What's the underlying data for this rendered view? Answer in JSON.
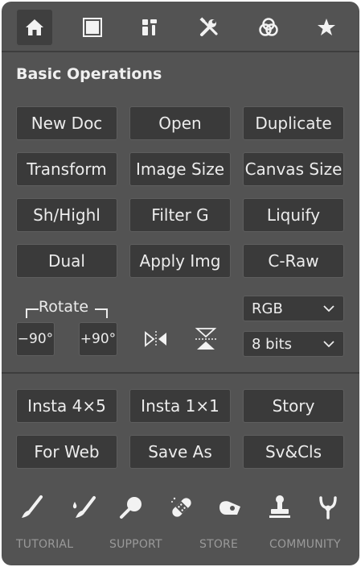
{
  "tabs": [
    {
      "icon": "home-icon",
      "active": true
    },
    {
      "icon": "frame-icon",
      "active": false
    },
    {
      "icon": "tools-palette-icon",
      "active": false
    },
    {
      "icon": "wrench-screwdriver-icon",
      "active": false
    },
    {
      "icon": "color-circles-icon",
      "active": false
    },
    {
      "icon": "star-icon",
      "active": false
    }
  ],
  "section": {
    "title": "Basic Operations"
  },
  "ops": {
    "row1": [
      "New Doc",
      "Open",
      "Duplicate"
    ],
    "row2": [
      "Transform",
      "Image Size",
      "Canvas Size"
    ],
    "row3": [
      "Sh/Highl",
      "Filter G",
      "Liquify"
    ],
    "row4": [
      "Dual",
      "Apply Img",
      "C-Raw"
    ]
  },
  "rotate": {
    "label": "Rotate",
    "ccw": "−90°",
    "cw": "+90°"
  },
  "flip": {
    "horizontal_icon": "flip-horizontal-icon",
    "vertical_icon": "flip-vertical-icon"
  },
  "mode": {
    "color_mode": "RGB",
    "bit_depth": "8 bits"
  },
  "export": {
    "row1": [
      "Insta 4×5",
      "Insta 1×1",
      "Story"
    ],
    "row2": [
      "For Web",
      "Save As",
      "Sv&Cls"
    ]
  },
  "tools": [
    "brush-icon",
    "mixer-brush-icon",
    "magnifier-icon",
    "bandage-icon",
    "eraser-icon",
    "stamp-icon",
    "fork-icon"
  ],
  "links": {
    "tutorial": "TUTORIAL",
    "support": "SUPPORT",
    "store": "STORE",
    "community": "COMMUNITY"
  },
  "colors": {
    "panel": "#535353",
    "button": "#3a3a3a",
    "text": "#ececec",
    "muted": "#9a9a9a"
  }
}
